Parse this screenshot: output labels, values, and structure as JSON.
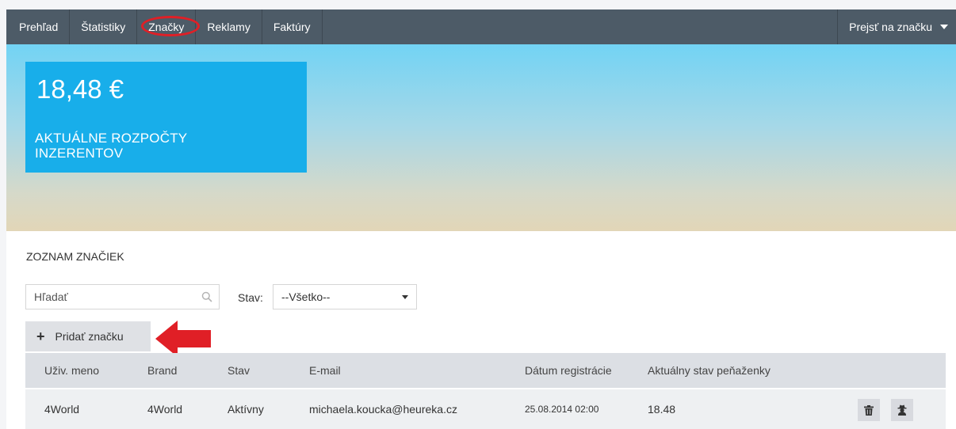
{
  "nav": {
    "items": [
      {
        "label": "Prehľad"
      },
      {
        "label": "Štatistiky"
      },
      {
        "label": "Značky"
      },
      {
        "label": "Reklamy"
      },
      {
        "label": "Faktúry"
      }
    ],
    "active_index": 2,
    "brand_switcher_label": "Prejsť na značku"
  },
  "budget": {
    "amount": "18,48 €",
    "label": "AKTUÁLNE ROZPOČTY INZERENTOV"
  },
  "list": {
    "title": "ZOZNAM ZNAČIEK",
    "search_placeholder": "Hľadať",
    "status_label": "Stav:",
    "status_selected": "--Všetko--",
    "add_button_label": "Pridať značku"
  },
  "table": {
    "headers": [
      "Uživ. meno",
      "Brand",
      "Stav",
      "E-mail",
      "Dátum registrácie",
      "Aktuálny stav peňaženky"
    ],
    "rows": [
      [
        "4World",
        "4World",
        "Aktívny",
        "michaela.koucka@heureka.cz",
        "25.08.2014 02:00",
        "18.48"
      ]
    ]
  },
  "colors": {
    "nav_bg": "#4d5b67",
    "card_bg": "#18aeea",
    "annotation_red": "#e01f26"
  }
}
